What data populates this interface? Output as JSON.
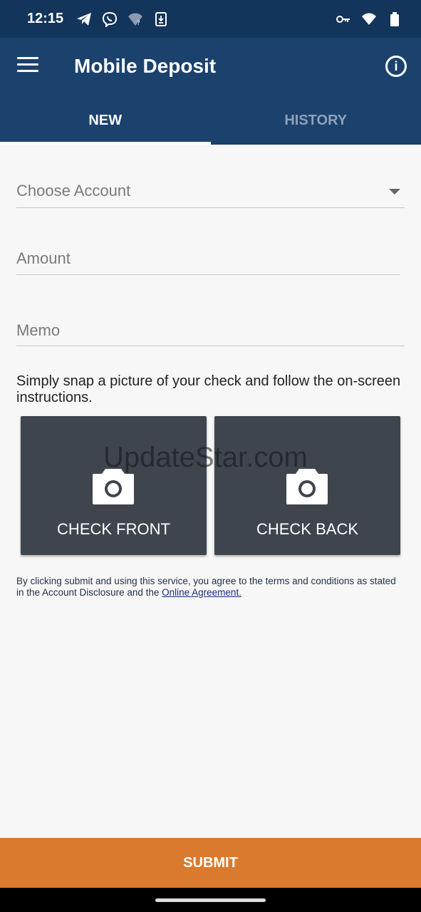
{
  "status_bar": {
    "time": "12:15",
    "left_icons": [
      "telegram-icon",
      "viber-icon",
      "wifi-question-icon",
      "download-icon"
    ],
    "right_icons": [
      "key-icon",
      "wifi-icon",
      "battery-icon"
    ]
  },
  "app_bar": {
    "title": "Mobile Deposit",
    "menu_icon": "hamburger-menu-icon",
    "info_icon": "info-icon",
    "info_glyph": "i"
  },
  "tabs": [
    {
      "label": "NEW",
      "active": true
    },
    {
      "label": "HISTORY",
      "active": false
    }
  ],
  "form": {
    "account_placeholder": "Choose Account",
    "amount_placeholder": "Amount",
    "memo_placeholder": "Memo"
  },
  "instructions": "Simply snap a picture of your check and follow the on-screen instructions.",
  "checks": {
    "front_label": "CHECK FRONT",
    "back_label": "CHECK BACK"
  },
  "watermark": "UpdateStar.com",
  "terms": {
    "text": "By clicking submit and using this service, you agree to the terms and conditions as stated in the Account Disclosure and the ",
    "link": "Online Agreement."
  },
  "submit_label": "SUBMIT",
  "colors": {
    "status_bar": "#13355b",
    "app_bar": "#1b416d",
    "check_button": "#3e454d",
    "submit": "#d97a2e"
  }
}
